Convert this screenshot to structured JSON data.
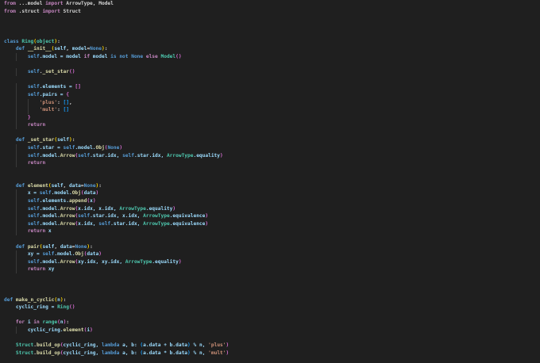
{
  "editor": {
    "lines": [
      [
        [
          "from",
          "k"
        ],
        [
          " ...model ",
          "p"
        ],
        [
          "import",
          "k"
        ],
        [
          " ArrowType, Model",
          "p"
        ]
      ],
      [
        [
          "from",
          "k"
        ],
        [
          " .struct ",
          "p"
        ],
        [
          "import",
          "k"
        ],
        [
          " Struct",
          "p"
        ]
      ],
      [],
      [],
      [],
      [
        [
          "class",
          "s"
        ],
        [
          " ",
          "p"
        ],
        [
          "Ring",
          "c"
        ],
        [
          "(",
          "b1"
        ],
        [
          "object",
          "c"
        ],
        [
          ")",
          "b1"
        ],
        [
          ":",
          "p"
        ]
      ],
      [
        [
          "    ",
          "p"
        ],
        [
          "def",
          "s"
        ],
        [
          " ",
          "p"
        ],
        [
          "__init__",
          "f"
        ],
        [
          "(",
          "b1"
        ],
        [
          "self",
          "v"
        ],
        [
          ", ",
          "p"
        ],
        [
          "model",
          "v"
        ],
        [
          "=",
          "p"
        ],
        [
          "None",
          "s"
        ],
        [
          ")",
          "b1"
        ],
        [
          ":",
          "p"
        ]
      ],
      [
        [
          "        ",
          "p"
        ],
        [
          "self",
          "s"
        ],
        [
          ".model = model ",
          "v"
        ],
        [
          "if",
          "k"
        ],
        [
          " model ",
          "v"
        ],
        [
          "is not None",
          "s"
        ],
        [
          " ",
          "p"
        ],
        [
          "else",
          "k"
        ],
        [
          " ",
          "p"
        ],
        [
          "Model",
          "c"
        ],
        [
          "()",
          "b2"
        ]
      ],
      [],
      [
        [
          "        ",
          "p"
        ],
        [
          "self",
          "s"
        ],
        [
          ".",
          "p"
        ],
        [
          "_set_star",
          "f"
        ],
        [
          "()",
          "b2"
        ]
      ],
      [],
      [
        [
          "        ",
          "p"
        ],
        [
          "self",
          "s"
        ],
        [
          ".elements = ",
          "v"
        ],
        [
          "[]",
          "b2"
        ]
      ],
      [
        [
          "        ",
          "p"
        ],
        [
          "self",
          "s"
        ],
        [
          ".pairs = ",
          "v"
        ],
        [
          "{",
          "b2"
        ]
      ],
      [
        [
          "            ",
          "p"
        ],
        [
          "'plus'",
          "str"
        ],
        [
          ": ",
          "p"
        ],
        [
          "[]",
          "b3"
        ],
        [
          ",",
          "p"
        ]
      ],
      [
        [
          "            ",
          "p"
        ],
        [
          "'mult'",
          "str"
        ],
        [
          ": ",
          "p"
        ],
        [
          "[]",
          "b3"
        ]
      ],
      [
        [
          "        ",
          "p"
        ],
        [
          "}",
          "b2"
        ]
      ],
      [
        [
          "        ",
          "p"
        ],
        [
          "return",
          "k"
        ]
      ],
      [],
      [
        [
          "    ",
          "p"
        ],
        [
          "def",
          "s"
        ],
        [
          " ",
          "p"
        ],
        [
          "_set_star",
          "f"
        ],
        [
          "(",
          "b1"
        ],
        [
          "self",
          "v"
        ],
        [
          ")",
          "b1"
        ],
        [
          ":",
          "p"
        ]
      ],
      [
        [
          "        ",
          "p"
        ],
        [
          "self",
          "s"
        ],
        [
          ".star = ",
          "v"
        ],
        [
          "self",
          "s"
        ],
        [
          ".model.",
          "v"
        ],
        [
          "Obj",
          "f"
        ],
        [
          "(",
          "b2"
        ],
        [
          "None",
          "s"
        ],
        [
          ")",
          "b2"
        ]
      ],
      [
        [
          "        ",
          "p"
        ],
        [
          "self",
          "s"
        ],
        [
          ".model.",
          "v"
        ],
        [
          "Arrow",
          "f"
        ],
        [
          "(",
          "b2"
        ],
        [
          "self",
          "s"
        ],
        [
          ".star.idx, ",
          "v"
        ],
        [
          "self",
          "s"
        ],
        [
          ".star.idx, ",
          "v"
        ],
        [
          "ArrowType",
          "c"
        ],
        [
          ".equality",
          "v"
        ],
        [
          ")",
          "b2"
        ]
      ],
      [
        [
          "        ",
          "p"
        ],
        [
          "return",
          "k"
        ]
      ],
      [],
      [],
      [
        [
          "    ",
          "p"
        ],
        [
          "def",
          "s"
        ],
        [
          " ",
          "p"
        ],
        [
          "element",
          "f"
        ],
        [
          "(",
          "b1"
        ],
        [
          "self",
          "v"
        ],
        [
          ", ",
          "p"
        ],
        [
          "data",
          "v"
        ],
        [
          "=",
          "p"
        ],
        [
          "None",
          "s"
        ],
        [
          ")",
          "b1"
        ],
        [
          ":",
          "p"
        ]
      ],
      [
        [
          "        ",
          "p"
        ],
        [
          "x = ",
          "v"
        ],
        [
          "self",
          "s"
        ],
        [
          ".model.",
          "v"
        ],
        [
          "Obj",
          "f"
        ],
        [
          "(",
          "b2"
        ],
        [
          "data",
          "v"
        ],
        [
          ")",
          "b2"
        ]
      ],
      [
        [
          "        ",
          "p"
        ],
        [
          "self",
          "s"
        ],
        [
          ".elements.",
          "v"
        ],
        [
          "append",
          "f"
        ],
        [
          "(",
          "b2"
        ],
        [
          "x",
          "v"
        ],
        [
          ")",
          "b2"
        ]
      ],
      [
        [
          "        ",
          "p"
        ],
        [
          "self",
          "s"
        ],
        [
          ".model.",
          "v"
        ],
        [
          "Arrow",
          "f"
        ],
        [
          "(",
          "b2"
        ],
        [
          "x.idx, x.idx, ",
          "v"
        ],
        [
          "ArrowType",
          "c"
        ],
        [
          ".equality",
          "v"
        ],
        [
          ")",
          "b2"
        ]
      ],
      [
        [
          "        ",
          "p"
        ],
        [
          "self",
          "s"
        ],
        [
          ".model.",
          "v"
        ],
        [
          "Arrow",
          "f"
        ],
        [
          "(",
          "b2"
        ],
        [
          "self",
          "s"
        ],
        [
          ".star.idx, x.idx, ",
          "v"
        ],
        [
          "ArrowType",
          "c"
        ],
        [
          ".equivalence",
          "v"
        ],
        [
          ")",
          "b2"
        ]
      ],
      [
        [
          "        ",
          "p"
        ],
        [
          "self",
          "s"
        ],
        [
          ".model.",
          "v"
        ],
        [
          "Arrow",
          "f"
        ],
        [
          "(",
          "b2"
        ],
        [
          "x.idx, ",
          "v"
        ],
        [
          "self",
          "s"
        ],
        [
          ".star.idx, ",
          "v"
        ],
        [
          "ArrowType",
          "c"
        ],
        [
          ".equivalence",
          "v"
        ],
        [
          ")",
          "b2"
        ]
      ],
      [
        [
          "        ",
          "p"
        ],
        [
          "return",
          "k"
        ],
        [
          " x",
          "v"
        ]
      ],
      [],
      [
        [
          "    ",
          "p"
        ],
        [
          "def",
          "s"
        ],
        [
          " ",
          "p"
        ],
        [
          "pair",
          "f"
        ],
        [
          "(",
          "b1"
        ],
        [
          "self",
          "v"
        ],
        [
          ", ",
          "p"
        ],
        [
          "data",
          "v"
        ],
        [
          "=",
          "p"
        ],
        [
          "None",
          "s"
        ],
        [
          ")",
          "b1"
        ],
        [
          ":",
          "p"
        ]
      ],
      [
        [
          "        ",
          "p"
        ],
        [
          "xy = ",
          "v"
        ],
        [
          "self",
          "s"
        ],
        [
          ".model.",
          "v"
        ],
        [
          "Obj",
          "f"
        ],
        [
          "(",
          "b2"
        ],
        [
          "data",
          "v"
        ],
        [
          ")",
          "b2"
        ]
      ],
      [
        [
          "        ",
          "p"
        ],
        [
          "self",
          "s"
        ],
        [
          ".model.",
          "v"
        ],
        [
          "Arrow",
          "f"
        ],
        [
          "(",
          "b2"
        ],
        [
          "xy.idx, xy.idx, ",
          "v"
        ],
        [
          "ArrowType",
          "c"
        ],
        [
          ".equality",
          "v"
        ],
        [
          ")",
          "b2"
        ]
      ],
      [
        [
          "        ",
          "p"
        ],
        [
          "return",
          "k"
        ],
        [
          " xy",
          "v"
        ]
      ],
      [],
      [],
      [],
      [
        [
          "def",
          "s"
        ],
        [
          " ",
          "p"
        ],
        [
          "make_n_cyclic",
          "f"
        ],
        [
          "(",
          "b1"
        ],
        [
          "n",
          "v"
        ],
        [
          ")",
          "b1"
        ],
        [
          ":",
          "p"
        ]
      ],
      [
        [
          "    ",
          "p"
        ],
        [
          "cyclic_ring = ",
          "v"
        ],
        [
          "Ring",
          "c"
        ],
        [
          "()",
          "b2"
        ]
      ],
      [],
      [
        [
          "    ",
          "p"
        ],
        [
          "for",
          "k"
        ],
        [
          " i ",
          "v"
        ],
        [
          "in",
          "k"
        ],
        [
          " ",
          "p"
        ],
        [
          "range",
          "c"
        ],
        [
          "(",
          "b2"
        ],
        [
          "n",
          "v"
        ],
        [
          ")",
          "b2"
        ],
        [
          ":",
          "p"
        ]
      ],
      [
        [
          "        ",
          "p"
        ],
        [
          "cyclic_ring.",
          "v"
        ],
        [
          "element",
          "f"
        ],
        [
          "(",
          "b2"
        ],
        [
          "i",
          "v"
        ],
        [
          ")",
          "b2"
        ]
      ],
      [],
      [
        [
          "    ",
          "p"
        ],
        [
          "Struct",
          "c"
        ],
        [
          ".",
          "p"
        ],
        [
          "build_op",
          "f"
        ],
        [
          "(",
          "b2"
        ],
        [
          "cyclic_ring, ",
          "v"
        ],
        [
          "lambda",
          "s"
        ],
        [
          " a, b: ",
          "v"
        ],
        [
          "(",
          "b3"
        ],
        [
          "a.data + b.data",
          "v"
        ],
        [
          ")",
          "b3"
        ],
        [
          " % n, ",
          "v"
        ],
        [
          "'plus'",
          "str"
        ],
        [
          ")",
          "b2"
        ]
      ],
      [
        [
          "    ",
          "p"
        ],
        [
          "Struct",
          "c"
        ],
        [
          ".",
          "p"
        ],
        [
          "build_op",
          "f"
        ],
        [
          "(",
          "b2"
        ],
        [
          "cyclic_ring, ",
          "v"
        ],
        [
          "lambda",
          "s"
        ],
        [
          " a, b: ",
          "v"
        ],
        [
          "(",
          "b3"
        ],
        [
          "a.data * b.data",
          "v"
        ],
        [
          ")",
          "b3"
        ],
        [
          " % n, ",
          "v"
        ],
        [
          "'mult'",
          "str"
        ],
        [
          ")",
          "b2"
        ]
      ]
    ]
  }
}
